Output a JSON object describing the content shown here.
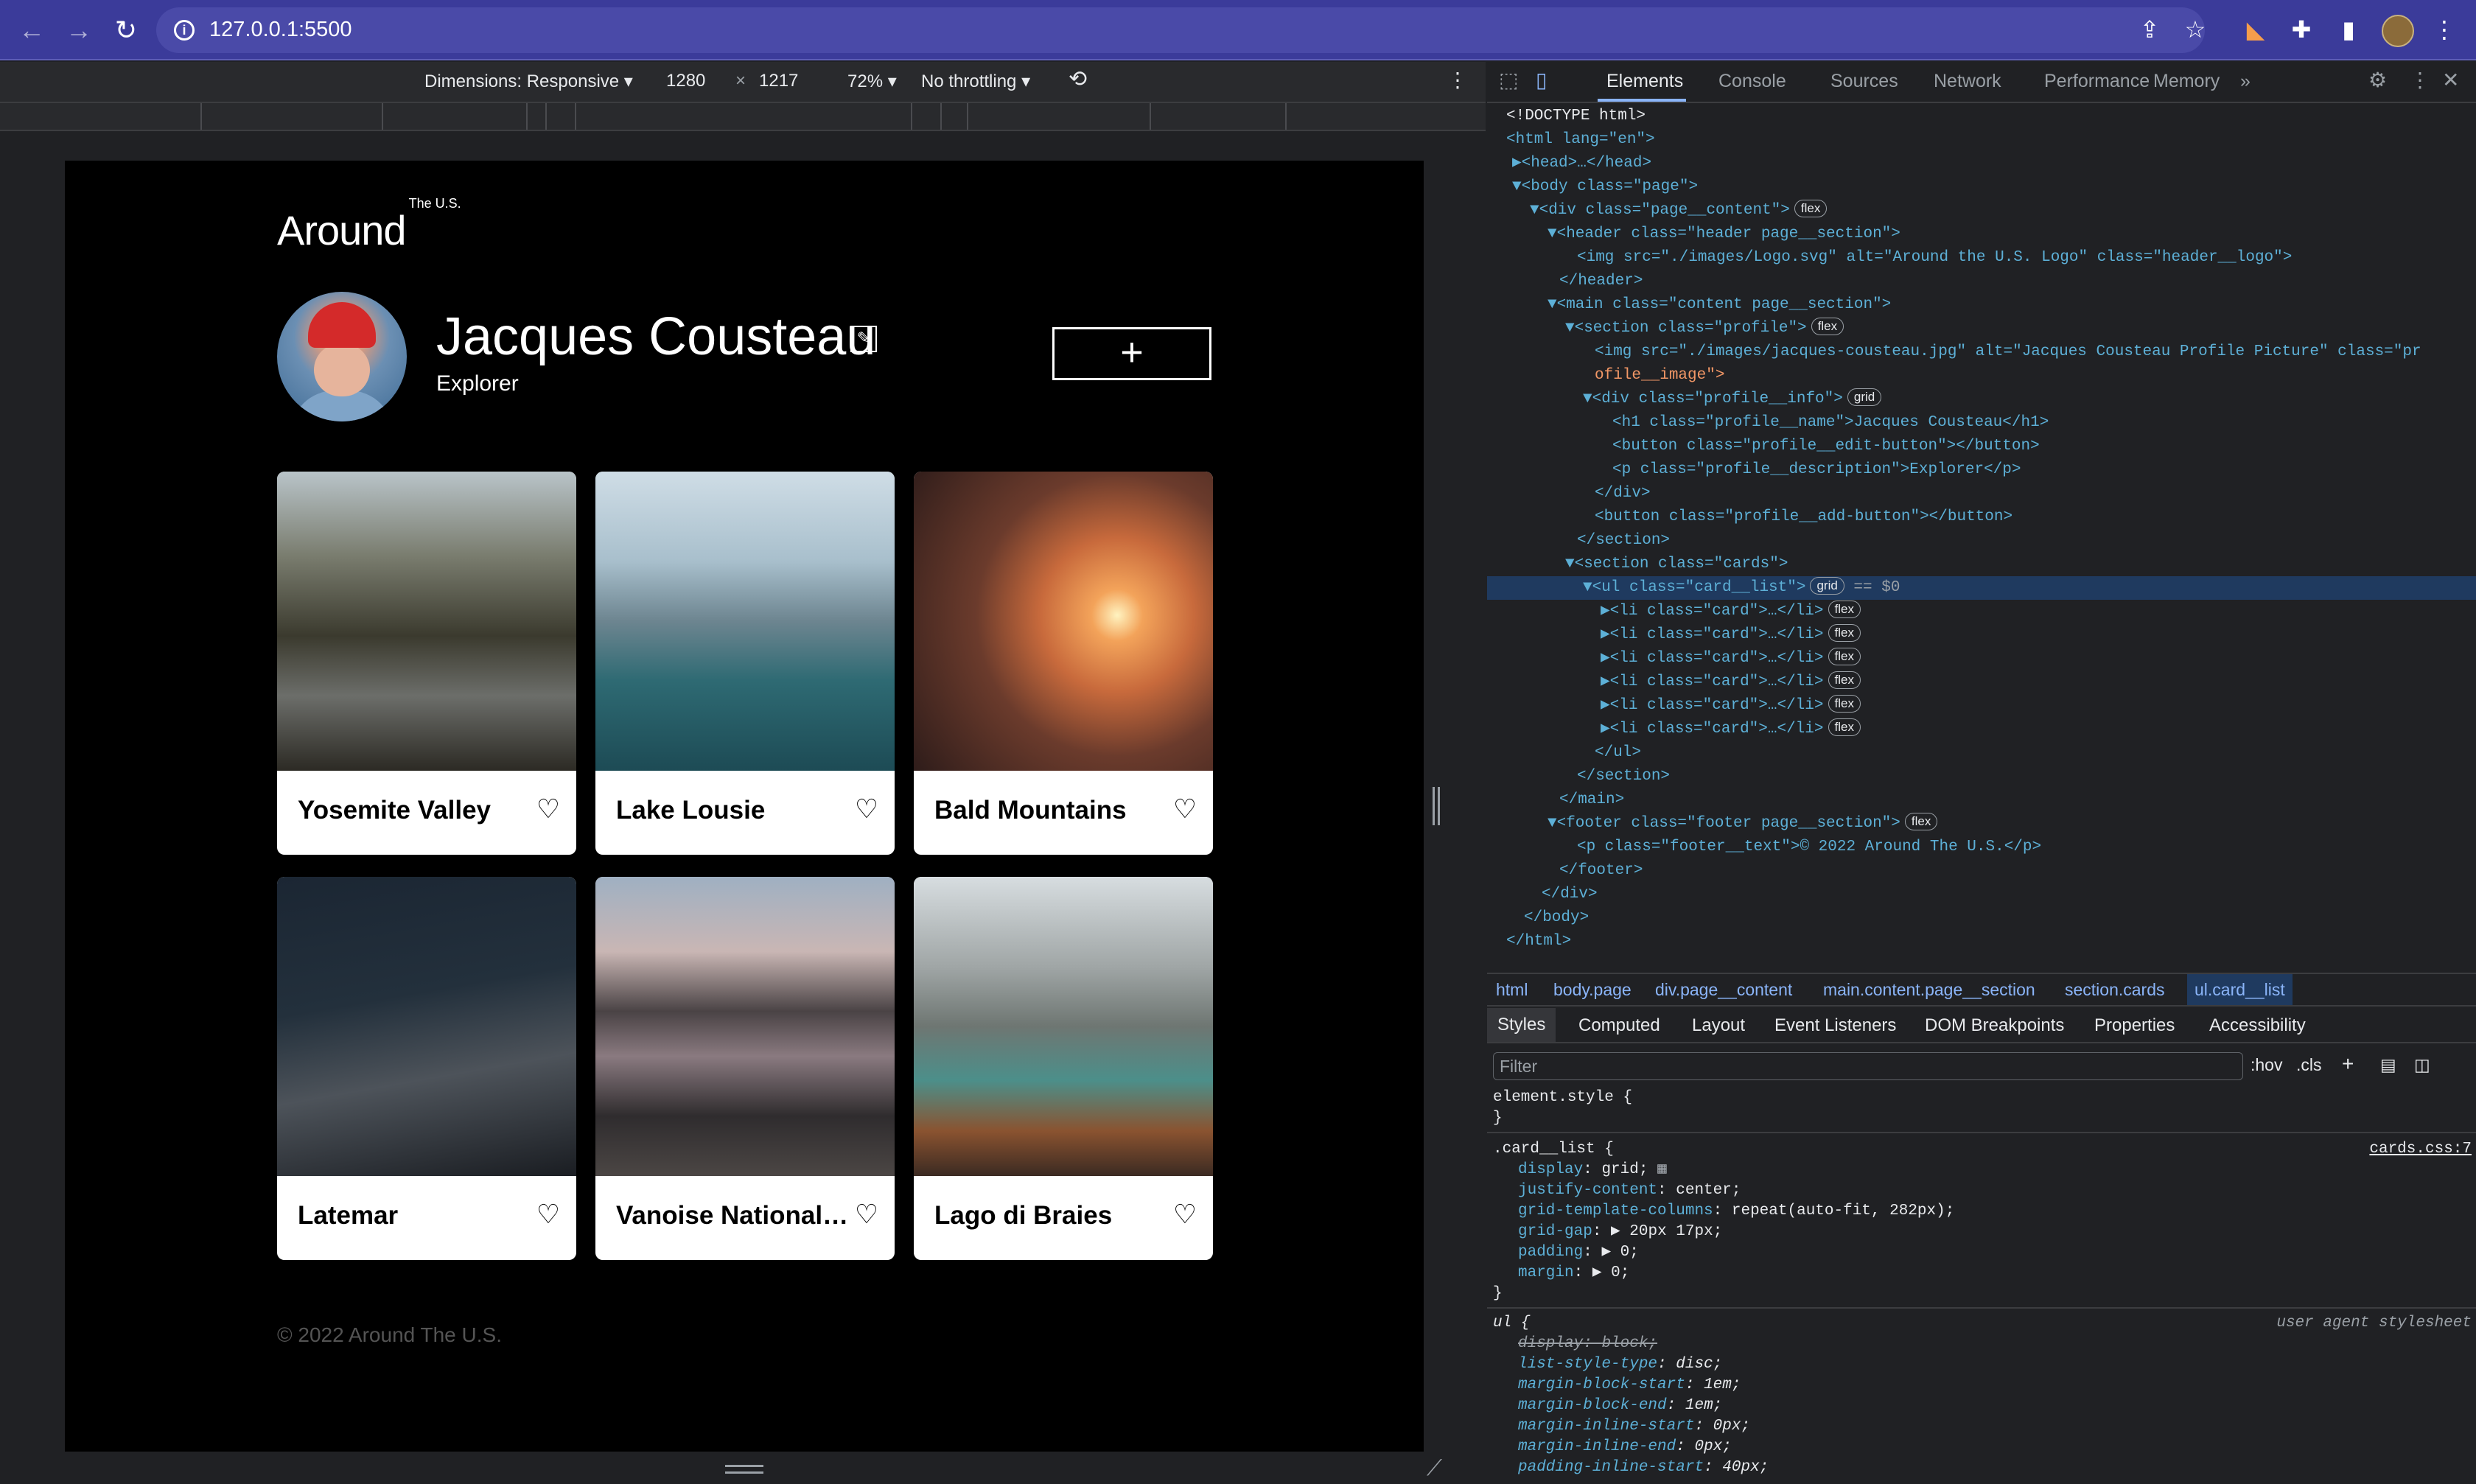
{
  "browser": {
    "url": "127.0.0.1:5500",
    "back_icon": "←",
    "forward_icon": "→",
    "reload_icon": "↻"
  },
  "devicebar": {
    "dimensions": "Dimensions: Responsive ▾",
    "width": "1280",
    "times": "×",
    "height": "1217",
    "zoom": "72% ▾",
    "throttling": "No throttling ▾"
  },
  "site": {
    "logo": "Around",
    "logo_sup": "The U.S.",
    "profile_name": "Jacques Cousteau",
    "profile_description": "Explorer",
    "add_button": "+",
    "edit_icon": "✎",
    "footer": "© 2022 Around The U.S.",
    "cards": [
      {
        "title": "Yosemite Valley"
      },
      {
        "title": "Lake Lousie"
      },
      {
        "title": "Bald Mountains"
      },
      {
        "title": "Latemar"
      },
      {
        "title": "Vanoise National Park"
      },
      {
        "title": "Lago di Braies"
      }
    ]
  },
  "devtools": {
    "tabs": [
      "Elements",
      "Console",
      "Sources",
      "Network",
      "Performance",
      "Memory",
      "»"
    ],
    "dom": [
      "<!DOCTYPE html>",
      "<html lang=\"en\">",
      "▶<head>…</head>",
      "▼<body class=\"page\">",
      "▼<div class=\"page__content\">",
      "▼<header class=\"header page__section\">",
      "<img src=\"./images/Logo.svg\" alt=\"Around the U.S. Logo\" class=\"header__logo\">",
      "</header>",
      "▼<main class=\"content page__section\">",
      "▼<section class=\"profile\">",
      "<img src=\"./images/jacques-cousteau.jpg\" alt=\"Jacques Cousteau Profile Picture\" class=\"pr",
      "ofile__image\">",
      "▼<div class=\"profile__info\">",
      "<h1 class=\"profile__name\">Jacques Cousteau</h1>",
      "<button class=\"profile__edit-button\"></button>",
      "<p class=\"profile__description\">Explorer</p>",
      "</div>",
      "<button class=\"profile__add-button\"></button>",
      "</section>",
      "▼<section class=\"cards\">",
      "▼<ul class=\"card__list\">",
      "▶<li class=\"card\">…</li>",
      "▶<li class=\"card\">…</li>",
      "▶<li class=\"card\">…</li>",
      "▶<li class=\"card\">…</li>",
      "▶<li class=\"card\">…</li>",
      "▶<li class=\"card\">…</li>",
      "</ul>",
      "</section>",
      "</main>",
      "▼<footer class=\"footer page__section\">",
      "<p class=\"footer__text\">© 2022 Around The U.S.</p>",
      "</footer>",
      "</div>",
      "</body>",
      "</html>"
    ],
    "badge_flex": "flex",
    "badge_grid": "grid",
    "sel_marker": "== $0",
    "breadcrumbs": [
      "html",
      "body.page",
      "div.page__content",
      "main.content.page__section",
      "section.cards",
      "ul.card__list"
    ],
    "style_tabs": [
      "Styles",
      "Computed",
      "Layout",
      "Event Listeners",
      "DOM Breakpoints",
      "Properties",
      "Accessibility"
    ],
    "filter_placeholder": "Filter",
    "hov": ":hov",
    "cls": ".cls",
    "styles": {
      "element_style": "element.style {",
      "close": "}",
      "rule_selector": ".card__list {",
      "rule_source": "cards.css:7",
      "props": [
        {
          "name": "display",
          "value": "grid;"
        },
        {
          "name": "justify-content",
          "value": "center;"
        },
        {
          "name": "grid-template-columns",
          "value": "repeat(auto-fit, 282px);"
        },
        {
          "name": "grid-gap",
          "value": "▶ 20px 17px;"
        },
        {
          "name": "padding",
          "value": "▶ 0;"
        },
        {
          "name": "margin",
          "value": "▶ 0;"
        }
      ],
      "ua_selector": "ul {",
      "ua_source": "user agent stylesheet",
      "ua_props": [
        {
          "name": "display",
          "value": "block;"
        },
        {
          "name": "list-style-type",
          "value": "disc;"
        },
        {
          "name": "margin-block-start",
          "value": "1em;"
        },
        {
          "name": "margin-block-end",
          "value": "1em;"
        },
        {
          "name": "margin-inline-start",
          "value": "0px;"
        },
        {
          "name": "margin-inline-end",
          "value": "0px;"
        },
        {
          "name": "padding-inline-start",
          "value": "40px;"
        }
      ]
    }
  }
}
